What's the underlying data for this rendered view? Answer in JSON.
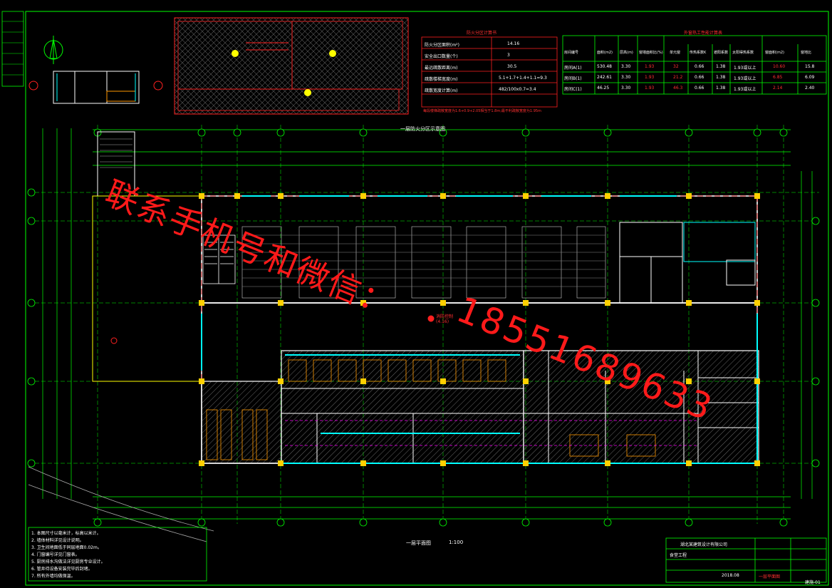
{
  "drawing": {
    "main_title": "一层平面图",
    "main_scale": "1:100",
    "inset_title": "一层防火分区示意图",
    "watermark_chinese": "联系手机号和微信：",
    "watermark_number": "18551689633",
    "room_label_area": "(4.16)",
    "room_label_area_2": "消防控制",
    "sheet_number": "建施-01"
  },
  "fire_table": {
    "title": "防火分区计算书",
    "rows": [
      {
        "label": "防火分区面积(m²)",
        "value": "14.16"
      },
      {
        "label": "安全出口数量(个)",
        "value": "3"
      },
      {
        "label": "最远疏散距离(m)",
        "value": "30.5"
      },
      {
        "label": "疏散楼梯宽度(m)",
        "value": "5.1+1.7+1.4+1.1=9.3"
      },
      {
        "label": "疏散宽度计算(m)",
        "value": "482/100x0.7=3.4"
      }
    ],
    "note": "每段楼梯疏散宽度为1.6+0.9+2.05相当于1.8m;最不利疏散宽度为1.95m"
  },
  "energy_table": {
    "title": "外窗热工性能计算表",
    "headers": [
      "房间编号",
      "面积(m2)",
      "层高(m)",
      "窗墙面积比(%)",
      "单元窗",
      "传热系数K",
      "遮阳系数",
      "太阳得热系数",
      "窗面积(m2)",
      "窗地比"
    ],
    "rows": [
      [
        "房间A(1)",
        "530.48",
        "3.30",
        "1.93",
        "32",
        "0.66",
        "1.38",
        "1.93或以上",
        "10.60",
        "15.8"
      ],
      [
        "房间B(1)",
        "242.61",
        "3.30",
        "1.93",
        "21.2",
        "0.66",
        "1.38",
        "1.93或以上",
        "6.85",
        "6.09"
      ],
      [
        "房间C(1)",
        "46.25",
        "3.30",
        "1.93",
        "46.3",
        "0.66",
        "1.38",
        "1.93或以上",
        "2.14",
        "2.40"
      ]
    ]
  },
  "notes": {
    "items": [
      "1. 本图尺寸以毫米计，标高以米计。",
      "2. 墙体材料详见设计说明。",
      "3. 卫生间地面低于同层地面0.02m。",
      "4. 门窗编号详见门窗表。",
      "5. 厨房排水沟做法详见厨房专业设计。",
      "6. 管井待设备安装完毕后封堵。",
      "7. 所有外墙均做保温。"
    ]
  },
  "title_block": {
    "company": "湖北某建筑设计有限公司",
    "drawing_name": "一层平面图",
    "project": "食堂工程",
    "date": "2018.08"
  },
  "colors": {
    "background": "#000000",
    "grid_line": "#00ff00",
    "wall": "#ffffff",
    "column": "#ffd000",
    "hatch": "#808080",
    "furniture": "#ff9900",
    "red": "#ff2020",
    "cyan": "#00ffff",
    "magenta": "#ff00ff",
    "watermark": "#ff1a1a"
  }
}
